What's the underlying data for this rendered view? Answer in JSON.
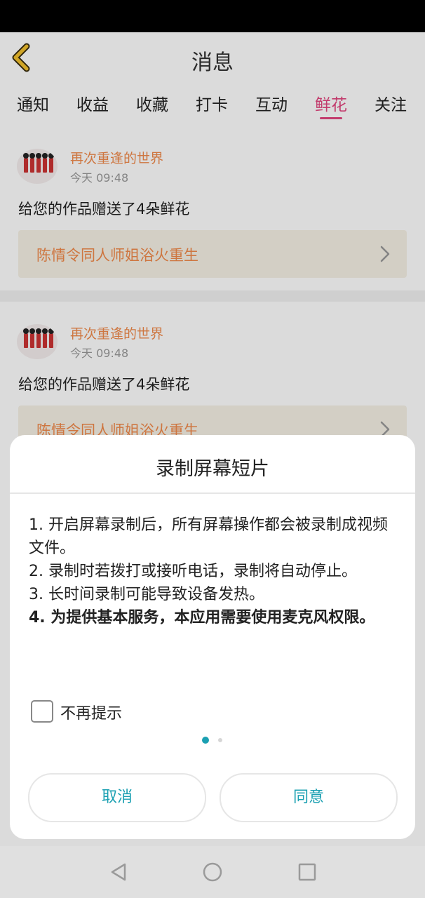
{
  "header": {
    "title": "消息"
  },
  "tabs": [
    {
      "label": "通知"
    },
    {
      "label": "收益"
    },
    {
      "label": "收藏"
    },
    {
      "label": "打卡"
    },
    {
      "label": "互动"
    },
    {
      "label": "鲜花",
      "active": true
    },
    {
      "label": "关注"
    }
  ],
  "messages": [
    {
      "username": "再次重逢的世界",
      "time": "今天 09:48",
      "text": "给您的作品赠送了4朵鲜花",
      "work_title": "陈情令同人师姐浴火重生"
    },
    {
      "username": "再次重逢的世界",
      "time": "今天 09:48",
      "text": "给您的作品赠送了4朵鲜花",
      "work_title": "陈情令同人师姐浴火重生"
    }
  ],
  "dialog": {
    "title": "录制屏幕短片",
    "items": [
      "1. 开启屏幕录制后，所有屏幕操作都会被录制成视频文件。",
      "2. 录制时若拨打或接听电话，录制将自动停止。",
      "3. 长时间录制可能导致设备发热。",
      "4. 为提供基本服务，本应用需要使用麦克风权限。"
    ],
    "checkbox_label": "不再提示",
    "checkbox_checked": false,
    "cancel_label": "取消",
    "agree_label": "同意",
    "page_count": 2,
    "current_page": 1
  },
  "colors": {
    "accent": "#e2457e",
    "username": "#f08a4b",
    "dialog_button": "#1ba0b2",
    "work_box_bg": "#f6f1e6"
  },
  "icons": {
    "back": "chevron-left-icon",
    "work_arrow": "chevron-right-icon",
    "nav_back": "triangle-back-icon",
    "nav_home": "circle-home-icon",
    "nav_recents": "square-recents-icon"
  }
}
